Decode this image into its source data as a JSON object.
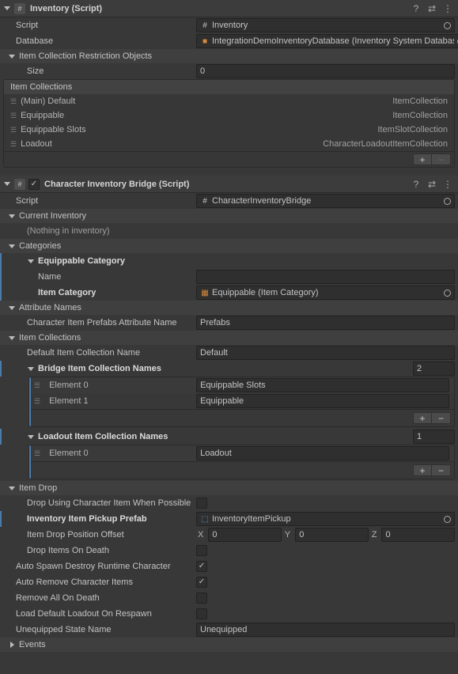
{
  "inventory": {
    "title": "Inventory (Script)",
    "script_label": "Script",
    "script_value": "Inventory",
    "database_label": "Database",
    "database_value": "IntegrationDemoInventoryDatabase (Inventory System Database)",
    "icro_label": "Item Collection Restriction Objects",
    "size_label": "Size",
    "size_value": "0",
    "collections_label": "Item Collections",
    "collections": [
      {
        "name": "(Main) Default",
        "type": "ItemCollection"
      },
      {
        "name": "Equippable",
        "type": "ItemCollection"
      },
      {
        "name": "Equippable Slots",
        "type": "ItemSlotCollection"
      },
      {
        "name": "Loadout",
        "type": "CharacterLoadoutItemCollection"
      }
    ]
  },
  "bridge": {
    "title": "Character Inventory Bridge (Script)",
    "checked": true,
    "script_label": "Script",
    "script_value": "CharacterInventoryBridge",
    "current_inventory_label": "Current Inventory",
    "current_inventory_empty": "(Nothing in inventory)",
    "categories_label": "Categories",
    "eq_category_label": "Equippable Category",
    "name_label": "Name",
    "name_value": "",
    "item_category_label": "Item Category",
    "item_category_value": "Equippable (Item Category)",
    "attr_names_label": "Attribute Names",
    "char_prefabs_label": "Character Item Prefabs Attribute Name",
    "char_prefabs_value": "Prefabs",
    "item_collections_label": "Item Collections",
    "default_icn_label": "Default Item Collection Name",
    "default_icn_value": "Default",
    "bridge_icn_label": "Bridge Item Collection Names",
    "bridge_icn_count": "2",
    "bridge_elements": [
      {
        "label": "Element 0",
        "value": "Equippable Slots"
      },
      {
        "label": "Element 1",
        "value": "Equippable"
      }
    ],
    "loadout_icn_label": "Loadout Item Collection Names",
    "loadout_icn_count": "1",
    "loadout_elements": [
      {
        "label": "Element 0",
        "value": "Loadout"
      }
    ],
    "item_drop_label": "Item Drop",
    "ducip_label": "Drop Using Character Item When Possible",
    "iipp_label": "Inventory Item Pickup Prefab",
    "iipp_value": "InventoryItemPickup",
    "idpo_label": "Item Drop Position Offset",
    "idpo": {
      "x_label": "X",
      "x": "0",
      "y_label": "Y",
      "y": "0",
      "z_label": "Z",
      "z": "0"
    },
    "diod_label": "Drop Items On Death",
    "asdrc_label": "Auto Spawn Destroy Runtime Character",
    "arci_label": "Auto Remove Character Items",
    "raod_label": "Remove All On Death",
    "ldlor_label": "Load Default Loadout On Respawn",
    "usn_label": "Unequipped State Name",
    "usn_value": "Unequipped",
    "events_label": "Events"
  }
}
